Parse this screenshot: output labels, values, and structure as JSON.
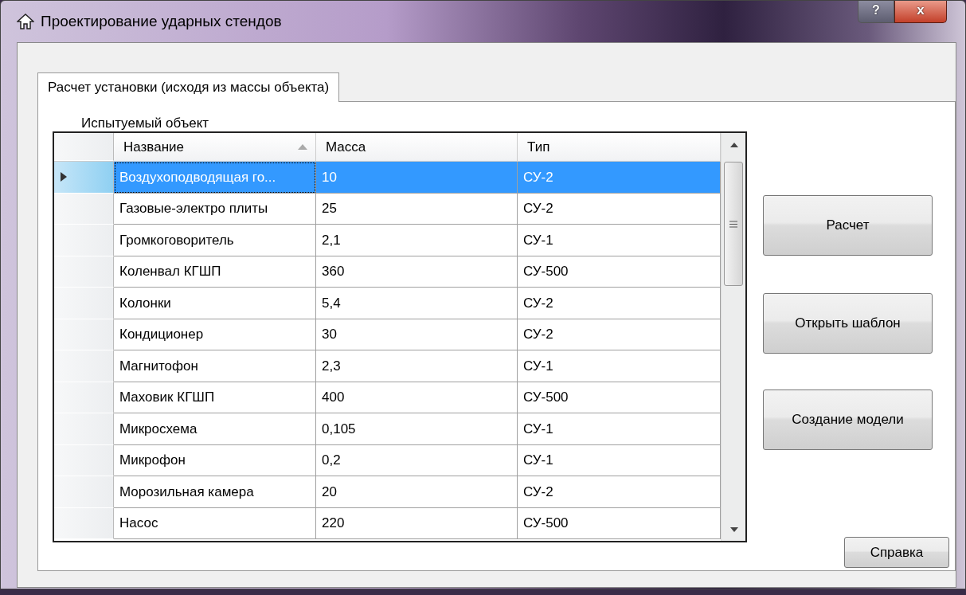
{
  "window": {
    "title": "Проектирование ударных стендов",
    "help_button": "?",
    "close_button": "x"
  },
  "tabs": [
    {
      "label": "Расчет установки (исходя из массы объекта)",
      "selected": true
    }
  ],
  "group_label": "Испытуемый объект",
  "table": {
    "columns": [
      {
        "label": "Название",
        "sorted": true
      },
      {
        "label": "Масса",
        "sorted": false
      },
      {
        "label": "Тип",
        "sorted": false
      }
    ],
    "rows": [
      {
        "name": "Воздухоподводящая го...",
        "mass": "10",
        "type": "СУ-2",
        "selected": true
      },
      {
        "name": "Газовые-электро плиты",
        "mass": "25",
        "type": "СУ-2",
        "selected": false
      },
      {
        "name": "Громкоговоритель",
        "mass": "2,1",
        "type": "СУ-1",
        "selected": false
      },
      {
        "name": "Коленвал КГШП",
        "mass": "360",
        "type": "СУ-500",
        "selected": false
      },
      {
        "name": "Колонки",
        "mass": "5,4",
        "type": "СУ-2",
        "selected": false
      },
      {
        "name": "Кондиционер",
        "mass": "30",
        "type": "СУ-2",
        "selected": false
      },
      {
        "name": "Магнитофон",
        "mass": "2,3",
        "type": "СУ-1",
        "selected": false
      },
      {
        "name": "Маховик КГШП",
        "mass": "400",
        "type": "СУ-500",
        "selected": false
      },
      {
        "name": "Микросхема",
        "mass": "0,105",
        "type": "СУ-1",
        "selected": false
      },
      {
        "name": "Микрофон",
        "mass": "0,2",
        "type": "СУ-1",
        "selected": false
      },
      {
        "name": "Морозильная камера",
        "mass": "20",
        "type": "СУ-2",
        "selected": false
      },
      {
        "name": "Насос",
        "mass": "220",
        "type": "СУ-500",
        "selected": false
      }
    ]
  },
  "buttons": [
    "Расчет",
    "Открыть шаблон",
    "Создание модели"
  ],
  "help_button": "Справка"
}
